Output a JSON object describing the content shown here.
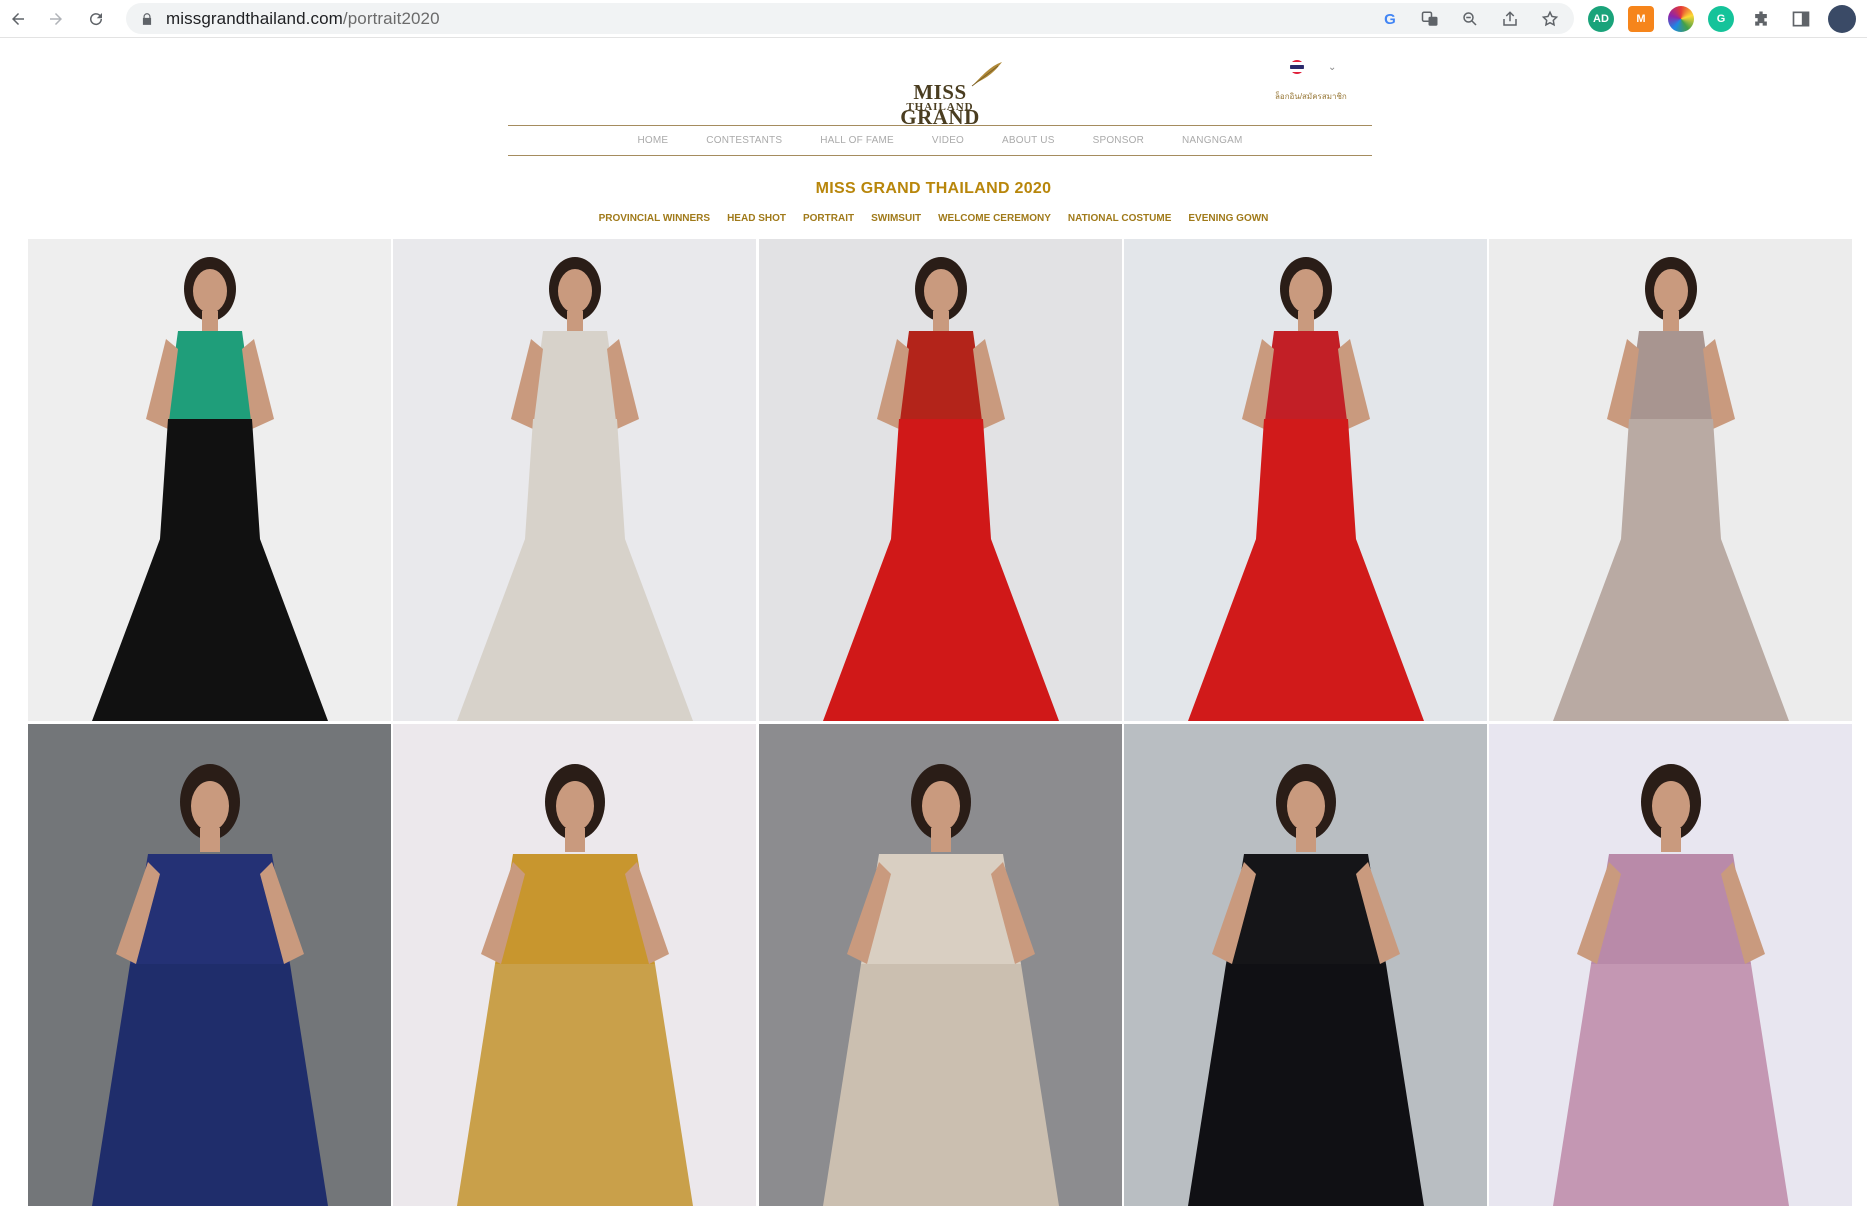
{
  "browser": {
    "url_host": "missgrandthailand.com",
    "url_path": "/portrait2020"
  },
  "header": {
    "logo_line1": "MISS GRAND",
    "logo_line2": "THAILAND",
    "login_text": "ล็อกอิน/สมัครสมาชิก"
  },
  "menu": [
    {
      "label": "HOME"
    },
    {
      "label": "CONTESTANTS"
    },
    {
      "label": "HALL OF FAME"
    },
    {
      "label": "VIDEO"
    },
    {
      "label": "ABOUT US"
    },
    {
      "label": "SPONSOR"
    },
    {
      "label": "NANGNGAM"
    }
  ],
  "page_title": "MISS GRAND THAILAND 2020",
  "subnav": [
    {
      "label": "PROVINCIAL WINNERS"
    },
    {
      "label": "HEAD SHOT"
    },
    {
      "label": "PORTRAIT"
    },
    {
      "label": "SWIMSUIT"
    },
    {
      "label": "WELCOME CEREMONY"
    },
    {
      "label": "NATIONAL COSTUME"
    },
    {
      "label": "EVENING GOWN"
    }
  ],
  "colors": {
    "accent_gold": "#b8860b",
    "menu_border": "#a58c5e"
  },
  "gallery": [
    {
      "bg": "#eeeeee",
      "gown": "#111111",
      "top": "#1f9e7a"
    },
    {
      "bg": "#e9e9ec",
      "gown": "#d7d2ca",
      "top": "#d7d2ca"
    },
    {
      "bg": "#e2e2e4",
      "gown": "#d01818",
      "top": "#b3241a"
    },
    {
      "bg": "#e3e6ea",
      "gown": "#d11a1a",
      "top": "#c21f26"
    },
    {
      "bg": "#ececec",
      "gown": "#b9aaa3",
      "top": "#a89590"
    },
    {
      "bg": "#737679",
      "gown": "#1f2d6b",
      "top": "#243175"
    },
    {
      "bg": "#ece8ec",
      "gown": "#c9a04a",
      "top": "#c8962e"
    },
    {
      "bg": "#8c8c8f",
      "gown": "#cbbfb0",
      "top": "#d9cfc2"
    },
    {
      "bg": "#b9bec2",
      "gown": "#101014",
      "top": "#151518"
    },
    {
      "bg": "#e8e6f0",
      "gown": "#c497b3",
      "top": "#b98aa9"
    }
  ]
}
